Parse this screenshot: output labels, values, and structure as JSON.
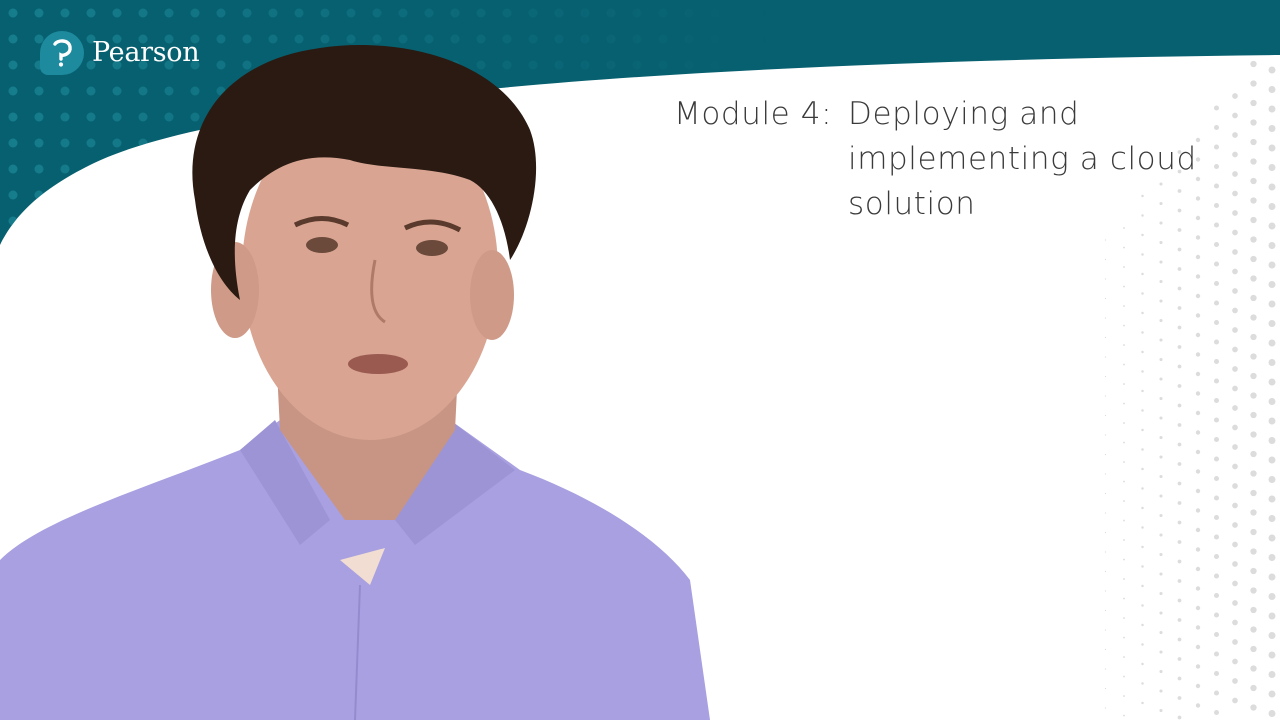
{
  "brand": {
    "name": "Pearson",
    "logo_icon": "pearson-p-icon",
    "colors": {
      "banner_teal": "#07606f",
      "banner_dot": "#1a8595",
      "logo_mark": "#1d8a9e",
      "title_text": "#3a3a3a",
      "background": "#ffffff",
      "halftone_dot": "#dcdcdc"
    }
  },
  "slide": {
    "module_label": "Module 4:",
    "title_lines": [
      "Deploying and",
      "implementing a cloud",
      "solution"
    ]
  },
  "presenter": {
    "description": "Presenter with curly dark hair wearing a lavender button-up shirt",
    "colors": {
      "hair": "#2a1a12",
      "skin": "#d9a592",
      "shirt": "#a8a0e0"
    }
  }
}
